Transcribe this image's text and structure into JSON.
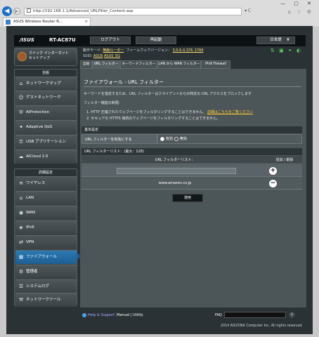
{
  "browser": {
    "url": "http://192.168.1.1/Advanced_URLFilter_Content.asp",
    "tab_title": "ASUS Wireless Router R...",
    "tab_close": "×",
    "back": "◀",
    "forward": "▶",
    "addr_buttons": "▾ C",
    "window_controls": "— ▢ ✕",
    "toolbar_icons": "⌂ ☆ ⚙"
  },
  "header": {
    "logo": "/ISUS",
    "model": "RT-AC87U",
    "logout": "ログアウト",
    "reboot": "再起動",
    "language": "日本語",
    "lang_arrow": "▼"
  },
  "qis": {
    "label": "クイック インターネット セットアップ",
    "icon": "globe-icon"
  },
  "sidebar": {
    "general_header": "全般",
    "general_items": [
      {
        "label": "ネットワークマップ",
        "icon": "⌂"
      },
      {
        "label": "ゲストネットワーク",
        "icon": "☺"
      },
      {
        "label": "AiProtection",
        "icon": "⛨"
      },
      {
        "label": "Adaptive QoS",
        "icon": "✦"
      },
      {
        "label": "USB アプリケーション",
        "icon": "⚿"
      },
      {
        "label": "AiCloud 2.0",
        "icon": "☁"
      }
    ],
    "advanced_header": "詳細設定",
    "advanced_items": [
      {
        "label": "ワイヤレス",
        "icon": "≋"
      },
      {
        "label": "LAN",
        "icon": "⌂"
      },
      {
        "label": "WAN",
        "icon": "◉"
      },
      {
        "label": "IPv6",
        "icon": "◈"
      },
      {
        "label": "VPN",
        "icon": "⇄"
      },
      {
        "label": "ファイアウォール",
        "icon": "▦"
      },
      {
        "label": "管理者",
        "icon": "⚙"
      },
      {
        "label": "システムログ",
        "icon": "☰"
      },
      {
        "label": "ネットワークツール",
        "icon": "⚒"
      }
    ]
  },
  "status": {
    "op_mode_label": "動作モード:",
    "op_mode": "無線ルーター",
    "firmware_label": "ファームウェアバージョン：",
    "firmware": "3.0.0.4.376_2769",
    "ssid_label": "SSID:",
    "ssid1": "ASUS",
    "ssid2": "ASUS_5G",
    "icons": "⇅ ▣ ⚭ ◐"
  },
  "tabs": [
    "全般",
    "URL フィルター",
    "キーワードフィルター",
    "LAN から WAN フィルター",
    "IPv6 Firewall"
  ],
  "content": {
    "title": "ファイアウォール - URL フィルター",
    "desc1": "キーワードを指定するため、URL フィルターはクライアントからの特定の URL アクセスをブロックします",
    "limits": "フィルター機能の制限：",
    "limit1": "1.  HTTP 圧縮されたウェブページをフィルタリングすることはできません。",
    "limit1_link": "詳細はこちらをご覧ください",
    "limit2": "2.  セキュアな HTTPS 接続のウェブページをフィルタリングすることはできません。",
    "basic_header": "基本設定",
    "enable_label": "URL フィルターを有効にする",
    "radio_enable": "有効",
    "radio_disable": "無効",
    "enabled": false,
    "list_header": "URL フィルターリスト：(最大：128)",
    "list_col": "URL フィルターリスト：",
    "action_col": "追加 / 削除",
    "url_input_value": "",
    "entries": [
      "www.amazon.co.jp"
    ],
    "add_symbol": "+",
    "remove_symbol": "−",
    "apply": "適用"
  },
  "footer": {
    "help": "Help & Support",
    "manual": "Manual | Utility",
    "faq": "FAQ",
    "search_icon": "⚲",
    "copyright": "2014 ASUSTeK Computer Inc. All rights reserved"
  }
}
